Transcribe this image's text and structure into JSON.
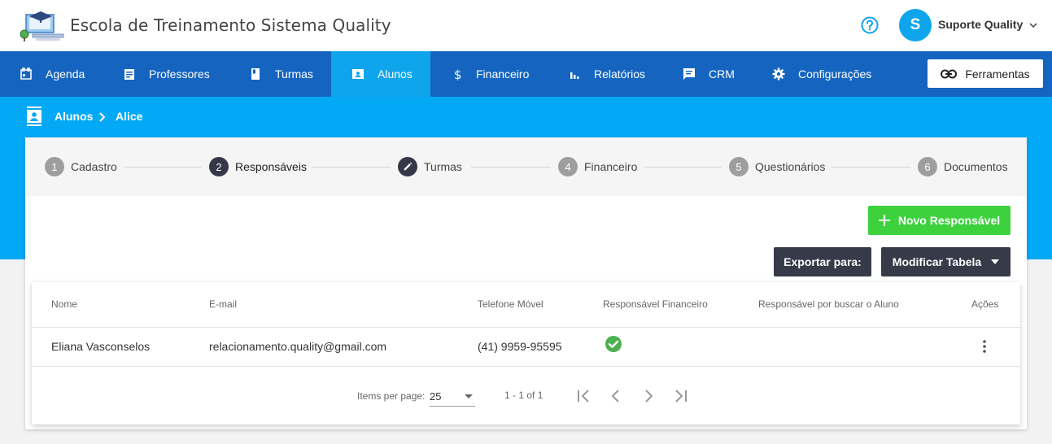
{
  "header": {
    "app_title": "Escola de Treinamento Sistema Quality",
    "avatar_initial": "S",
    "user_name": "Suporte Quality"
  },
  "nav": {
    "items": [
      {
        "label": "Agenda",
        "icon": "calendar-icon"
      },
      {
        "label": "Professores",
        "icon": "clipboard-icon"
      },
      {
        "label": "Turmas",
        "icon": "book-icon"
      },
      {
        "label": "Alunos",
        "icon": "contact-card-icon",
        "active": true
      },
      {
        "label": "Financeiro",
        "icon": "dollar-icon"
      },
      {
        "label": "Relatórios",
        "icon": "bar-chart-icon"
      },
      {
        "label": "CRM",
        "icon": "chat-icon"
      },
      {
        "label": "Configurações",
        "icon": "gear-icon"
      }
    ],
    "tools_label": "Ferramentas"
  },
  "breadcrumb": {
    "section": "Alunos",
    "current": "Alice"
  },
  "stepper": {
    "steps": [
      {
        "number": "1",
        "label": "Cadastro"
      },
      {
        "number": "2",
        "label": "Responsáveis",
        "active": true
      },
      {
        "number": "",
        "label": "Turmas",
        "editing": true
      },
      {
        "number": "4",
        "label": "Financeiro"
      },
      {
        "number": "5",
        "label": "Questionários"
      },
      {
        "number": "6",
        "label": "Documentos"
      }
    ]
  },
  "actions": {
    "new_label": "Novo Responsável",
    "export_label": "Exportar para:",
    "modify_label": "Modificar Tabela"
  },
  "table": {
    "columns": [
      "Nome",
      "E-mail",
      "Telefone Móvel",
      "Responsável Financeiro",
      "Responsável por buscar o Aluno",
      "Ações"
    ],
    "rows": [
      {
        "nome": "Eliana Vasconselos",
        "email": "relacionamento.quality@gmail.com",
        "telefone": "(41) 9959-95595",
        "financeiro": true,
        "buscar": false
      }
    ]
  },
  "paginator": {
    "items_per_page_label": "Items per page:",
    "page_size": "25",
    "range": "1 - 1 of 1"
  },
  "colors": {
    "nav": "#1565c0",
    "nav_active": "#0ea5ec",
    "band": "#03a9f4",
    "success": "#3dd23d",
    "dark_button": "#373a49"
  }
}
